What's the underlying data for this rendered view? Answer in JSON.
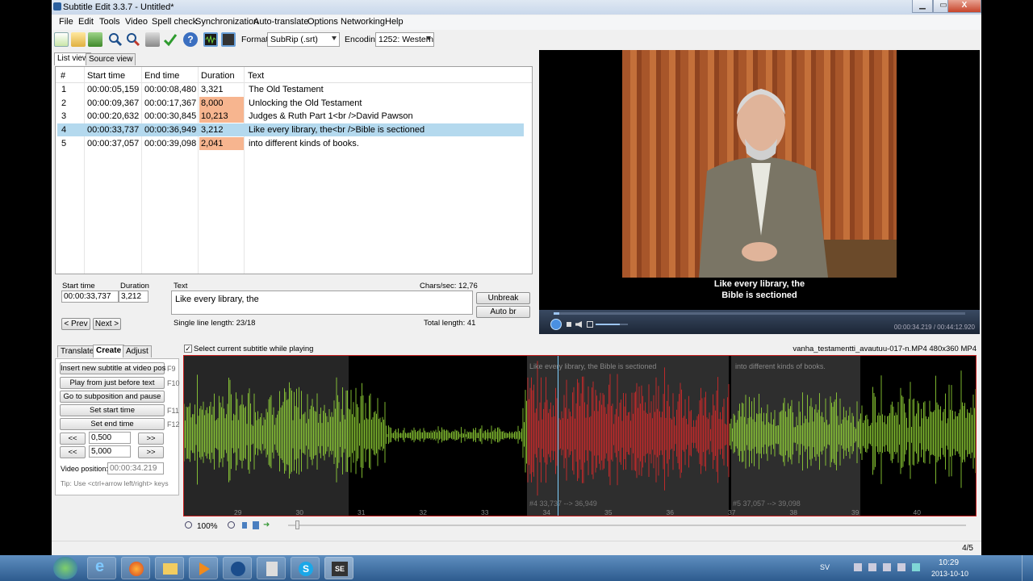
{
  "window": {
    "title": "Subtitle Edit 3.3.7 - Untitled*",
    "min": "▁",
    "max": "▭",
    "close": "X"
  },
  "menu": [
    "File",
    "Edit",
    "Tools",
    "Video",
    "Spell check",
    "Synchronization",
    "Auto-translate",
    "Options",
    "Networking",
    "Help"
  ],
  "toolbar": {
    "format_label": "Format",
    "format_value": "SubRip (.srt)",
    "encoding_label": "Encoding",
    "encoding_value": "1252: Western",
    "icons": [
      "new-file-icon",
      "open-folder-icon",
      "save-icon",
      "find-icon",
      "replace-icon",
      "fix-icon",
      "spell-check-icon",
      "help-icon",
      "waveform-toggle-icon",
      "video-toggle-icon"
    ]
  },
  "tabs": {
    "list_view": "List view",
    "source_view": "Source view"
  },
  "table": {
    "headers": [
      "#",
      "Start time",
      "End time",
      "Duration",
      "Text"
    ],
    "rows": [
      {
        "num": "1",
        "start": "00:00:05,159",
        "end": "00:00:08,480",
        "duration": "3,321",
        "text": "The Old Testament",
        "warn": false,
        "selected": false
      },
      {
        "num": "2",
        "start": "00:00:09,367",
        "end": "00:00:17,367",
        "duration": "8,000",
        "text": "Unlocking the Old Testament",
        "warn": true,
        "selected": false
      },
      {
        "num": "3",
        "start": "00:00:20,632",
        "end": "00:00:30,845",
        "duration": "10,213",
        "text": "Judges & Ruth Part 1<br />David Pawson",
        "warn": true,
        "selected": false
      },
      {
        "num": "4",
        "start": "00:00:33,737",
        "end": "00:00:36,949",
        "duration": "3,212",
        "text": "Like every library, the<br />Bible is sectioned",
        "warn": false,
        "selected": true
      },
      {
        "num": "5",
        "start": "00:00:37,057",
        "end": "00:00:39,098",
        "duration": "2,041",
        "text": "into different kinds of books.",
        "warn": true,
        "selected": false
      }
    ]
  },
  "editor": {
    "start_label": "Start time",
    "duration_label": "Duration",
    "text_label": "Text",
    "chars_sec": "Chars/sec: 12,76",
    "start_value": "00:00:33,737",
    "duration_value": "3,212",
    "text_value": "Like every library, the",
    "unbreak": "Unbreak",
    "auto_br": "Auto br",
    "prev": "< Prev",
    "next": "Next >",
    "single_line": "Single line length: 23/18",
    "total_length": "Total length: 41"
  },
  "video": {
    "subtitle_line1": "Like every library, the",
    "subtitle_line2": "Bible is sectioned",
    "time_readout": "00:00:34.219 / 00:44:12.920",
    "progress": 0.013,
    "volume": 0.75
  },
  "lower_tabs": [
    "Translate",
    "Create",
    "Adjust"
  ],
  "create_panel": {
    "insert": "Insert new subtitle at video pos",
    "insert_key": "F9",
    "play_before": "Play from just before text",
    "play_before_key": "F10",
    "goto_sub": "Go to subposition and pause",
    "set_start": "Set start time",
    "set_start_key": "F11",
    "set_end": "Set end time",
    "set_end_key": "F12",
    "back": "<<",
    "forward": ">>",
    "step1": "0,500",
    "step2": "5,000",
    "video_pos_label": "Video position:",
    "video_pos_value": "00:00:34.219",
    "tip": "Tip: Use <ctrl+arrow left/right> keys"
  },
  "waveform": {
    "select_checkbox_label": "Select current subtitle while playing",
    "select_checked": true,
    "file_info": "vanha_testamentti_avautuu-017-n.MP4 480x360 MP4",
    "seg4_text": "Like every library, the  Bible is sectioned",
    "seg5_text": "into different kinds of books.",
    "seg4_time": "#4  33,737 --> 36,949",
    "seg5_time": "#5  37,057 --> 39,098",
    "ticks": [
      "29",
      "30",
      "31",
      "32",
      "33",
      "34",
      "35",
      "36",
      "37",
      "38",
      "39",
      "40"
    ],
    "zoom": "100%"
  },
  "status": {
    "count": "4/5"
  },
  "taskbar": {
    "lang": "SV",
    "time": "10:29",
    "date": "2013-10-10"
  }
}
